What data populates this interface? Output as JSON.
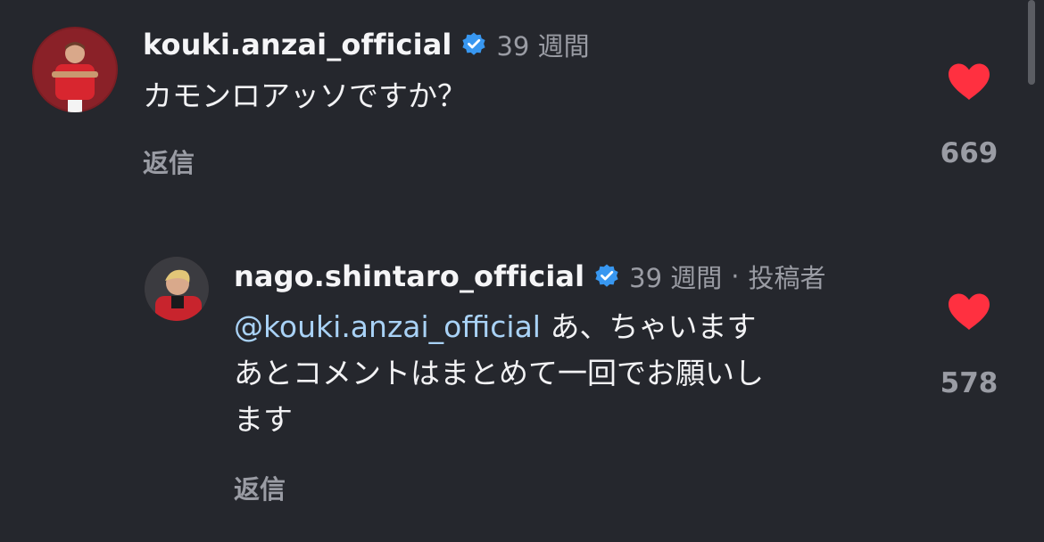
{
  "comments": [
    {
      "username": "kouki.anzai_official",
      "verified_icon": "verified-badge-icon",
      "age": "39 週間",
      "text": "カモンロアッソですか？",
      "reply_label": "返信",
      "like_count": "669",
      "liked": true
    },
    {
      "username": "nago.shintaro_official",
      "verified_icon": "verified-badge-icon",
      "age": "39 週間",
      "separator": "·",
      "author_tag": "投稿者",
      "mention": "@kouki.anzai_official",
      "text_line1": "あ、ちゃいます",
      "text_line2": "あとコメントはまとめて一回でお願いし",
      "text_line3": "ます",
      "reply_label": "返信",
      "like_count": "578",
      "liked": true
    }
  ],
  "colors": {
    "background": "#25272d",
    "verified": "#3897f0",
    "heart": "#ff3040",
    "mention": "#a9d2f6",
    "muted": "#9a9ca4"
  }
}
